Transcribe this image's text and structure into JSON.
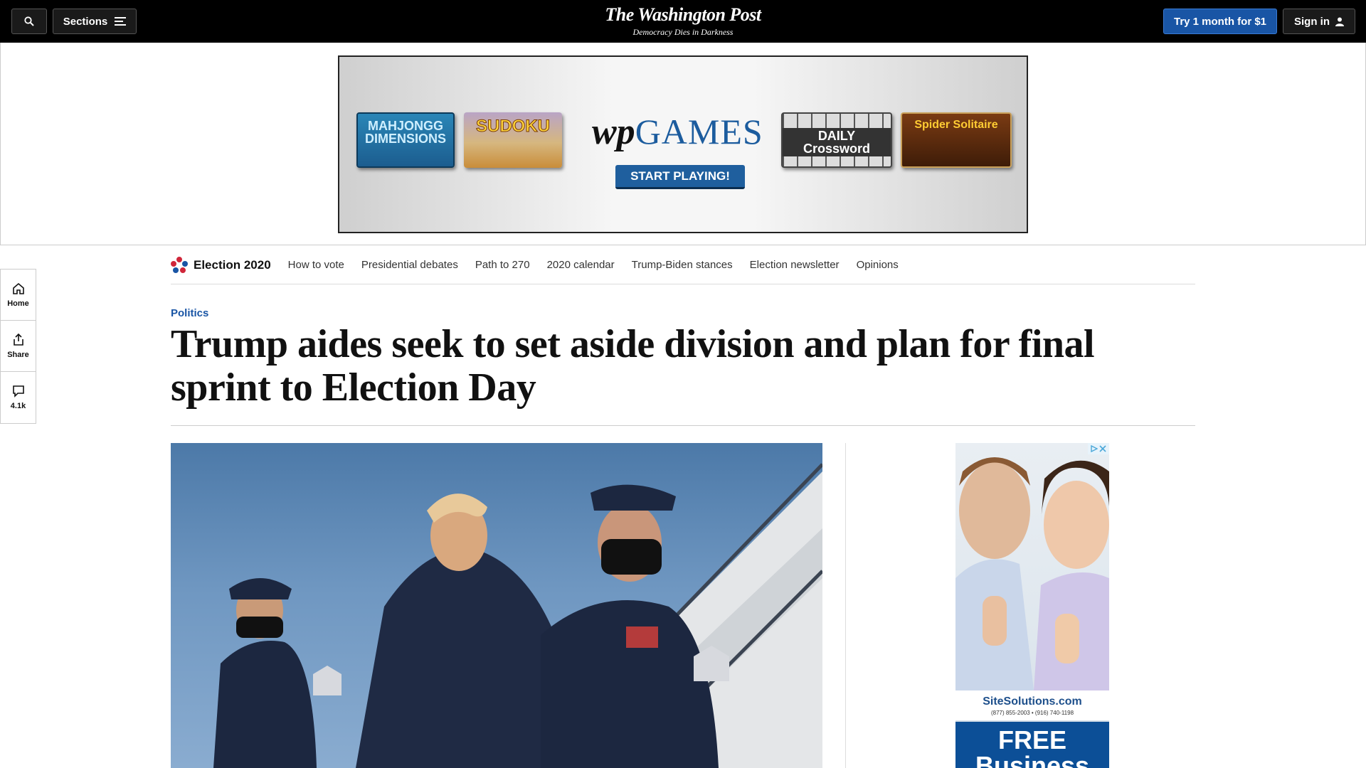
{
  "header": {
    "sections_label": "Sections",
    "logo": "The Washington Post",
    "tagline": "Democracy Dies in Darkness",
    "try_label": "Try 1 month for $1",
    "signin_label": "Sign in"
  },
  "top_ad": {
    "tiles": [
      "MAHJONGG DIMENSIONS",
      "SUDOKU",
      "DAILY Crossword",
      "Spider Solitaire"
    ],
    "logo_wp": "wp",
    "logo_games": "GAMES",
    "cta": "START PLAYING!"
  },
  "left_rail": {
    "home": "Home",
    "share": "Share",
    "comments": "4.1k"
  },
  "election_nav": {
    "title": "Election 2020",
    "links": [
      "How to vote",
      "Presidential debates",
      "Path to 270",
      "2020 calendar",
      "Trump-Biden stances",
      "Election newsletter",
      "Opinions"
    ]
  },
  "article": {
    "kicker": "Politics",
    "headline": "Trump aides seek to set aside division and plan for final sprint to Election Day"
  },
  "side_ad": {
    "brand": "SiteSolutions.com",
    "phone": "(877) 855-2003 • (916) 740-1198",
    "promo": "FREE Business"
  },
  "colors": {
    "accent": "#1955a5",
    "topbar": "#000000"
  }
}
